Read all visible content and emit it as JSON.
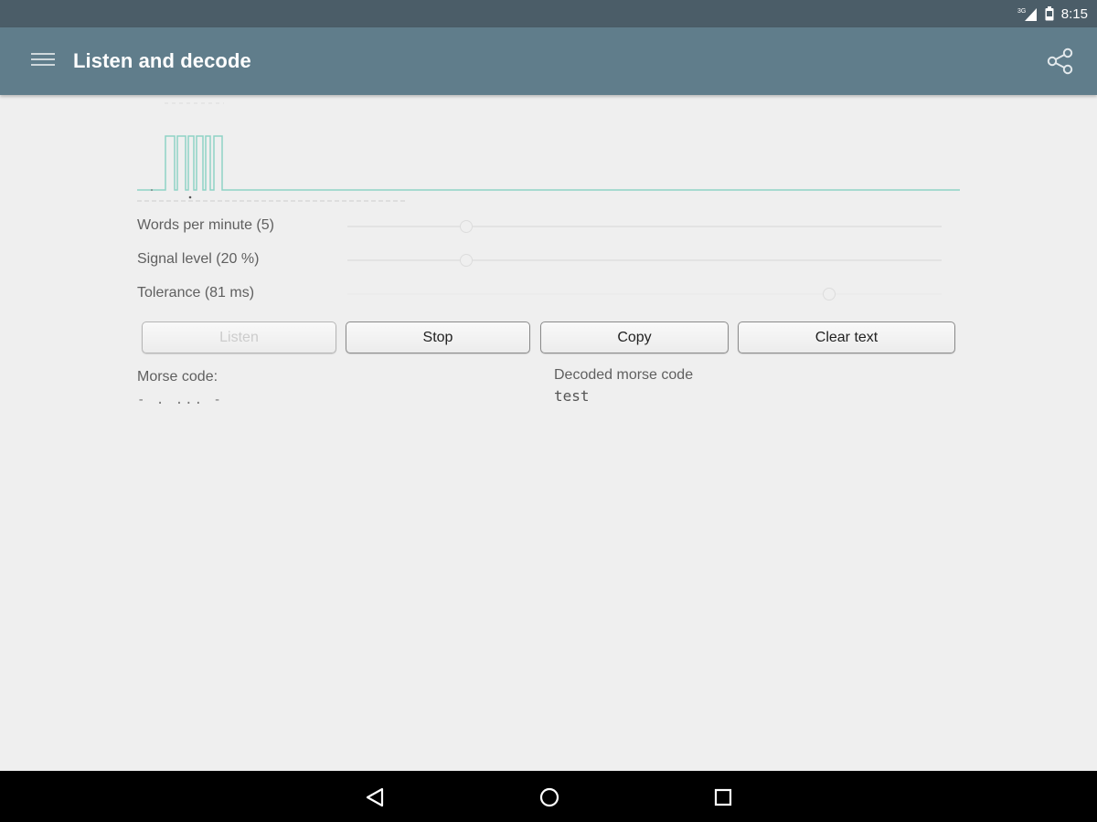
{
  "status_bar": {
    "network": "3G",
    "time": "8:15",
    "icons": [
      "signal-icon",
      "battery-icon"
    ]
  },
  "app_bar": {
    "title": "Listen and decode",
    "menu_icon": "menu-icon",
    "share_icon": "share-icon"
  },
  "sliders": [
    {
      "label": "Words per minute (5)",
      "level": 0.2
    },
    {
      "label": "Signal level (20 %)",
      "level": 0.2
    },
    {
      "label": "Tolerance (81 ms)",
      "level": 0.81
    }
  ],
  "buttons": [
    {
      "label": "Listen",
      "enabled": false
    },
    {
      "label": "Stop",
      "enabled": true
    },
    {
      "label": "Copy",
      "enabled": true
    },
    {
      "label": "Clear text",
      "enabled": true
    }
  ],
  "morse_code": {
    "label": "Morse code:",
    "value": "- . ... -"
  },
  "decoded": {
    "label": "Decoded morse code",
    "value": "test"
  },
  "colors": {
    "status_bar": "#4b5d68",
    "app_bar": "#607d8b",
    "background": "#efefef",
    "waveform": "#8fd3c6",
    "nav_bar": "#000000"
  },
  "nav_bar": {
    "icons": [
      "back-icon",
      "home-icon",
      "recents-icon"
    ]
  }
}
